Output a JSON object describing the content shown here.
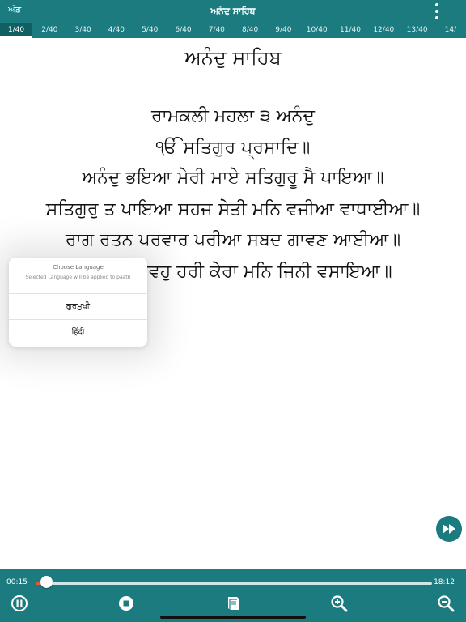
{
  "header": {
    "language_button": "ਅੰਗ਼",
    "title": "ਅਨੰਦੁ ਸਾਹਿਬ"
  },
  "page_tabs": [
    "1/40",
    "2/40",
    "3/40",
    "4/40",
    "5/40",
    "6/40",
    "7/40",
    "8/40",
    "9/40",
    "10/40",
    "11/40",
    "12/40",
    "13/40",
    "14/"
  ],
  "active_tab_index": 0,
  "content": {
    "heading": "ਅਨੰਦੁ ਸਾਹਿਬ",
    "verses": [
      "ਰਾਮਕਲੀ ਮਹਲਾ ੩ ਅਨੰਦੁ",
      "ੴ ਸਤਿਗੁਰ ਪ੍ਰਸਾਦਿ॥",
      "ਅਨੰਦੁ ਭਇਆ ਮੇਰੀ ਮਾਏ ਸਤਿਗੁਰੂ ਮੈ ਪਾਇਆ॥",
      "ਸਤਿਗੁਰੁ ਤ ਪਾਇਆ ਸਹਜ ਸੇਤੀ ਮਨਿ ਵਜੀਆ ਵਾਧਾਈਆ॥",
      "ਰਾਗ ਰਤਨ ਪਰਵਾਰ ਪਰੀਆ ਸਬਦ ਗਾਵਣ ਆਈਆ॥",
      "ਸਬਦੋ ਤ ਗਾਵਹੁ ਹਰੀ ਕੇਰਾ ਮਨਿ ਜਿਨੀ ਵਸਾਇਆ॥"
    ]
  },
  "language_popup": {
    "title": "Choose Language",
    "subtitle": "Selected Language will be applied to paath",
    "options": [
      "ਗੁਰਮੁਖੀ",
      "हिंदी"
    ]
  },
  "player": {
    "current_time": "00:15",
    "total_time": "18:12",
    "progress": 0.014
  },
  "icons": {
    "more": "more-vertical-icon",
    "fast_forward": "fast-forward-icon",
    "pause": "pause-icon",
    "stop": "stop-icon",
    "book": "book-icon",
    "zoom_in": "zoom-in-icon",
    "zoom_out": "zoom-out-icon"
  },
  "colors": {
    "accent": "#1b7b7f",
    "progress": "#e4563d"
  }
}
